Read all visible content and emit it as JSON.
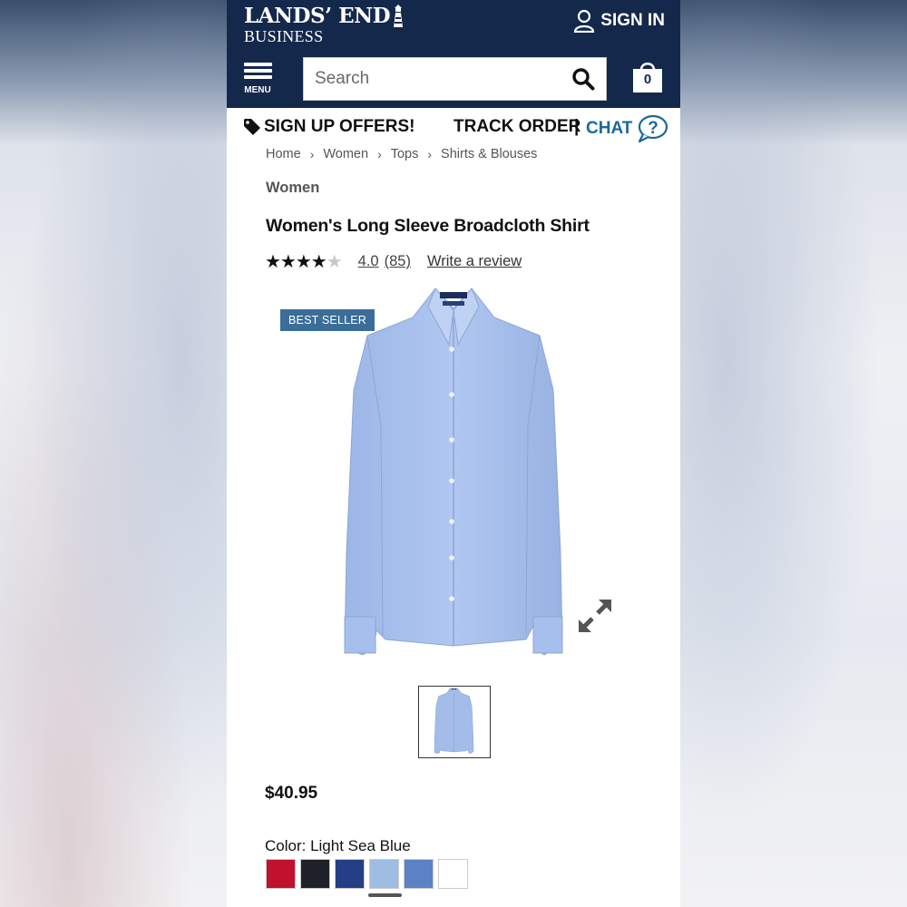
{
  "header": {
    "brand_name": "LANDS’ END",
    "brand_sub": "BUSINESS",
    "sign_in": "SIGN IN",
    "menu_label": "MENU",
    "search_placeholder": "Search",
    "cart_count": "0"
  },
  "promo": {
    "signup": "SIGN UP OFFERS!",
    "track": "TRACK ORDER",
    "pipe": "|",
    "chat": "CHAT"
  },
  "breadcrumb": [
    "Home",
    "Women",
    "Tops",
    "Shirts & Blouses"
  ],
  "product": {
    "category": "Women",
    "title": "Women's Long Sleeve Broadcloth Shirt",
    "stars_filled": "★★★★",
    "stars_empty": "★",
    "rating": "4.0",
    "review_count": "(85)",
    "write_review": "Write a review",
    "badge": "BEST SELLER",
    "price": "$40.95",
    "color_label": "Color: Light Sea Blue",
    "swatches": [
      "#c0112f",
      "#1f2128",
      "#243f86",
      "#9fbde3",
      "#5b82c4",
      "#ffffff"
    ]
  },
  "colors": {
    "navy": "#14284b",
    "chat_blue": "#1b6a99",
    "badge_blue": "#3b6d99",
    "shirt_blue": "#a9c2ee"
  }
}
